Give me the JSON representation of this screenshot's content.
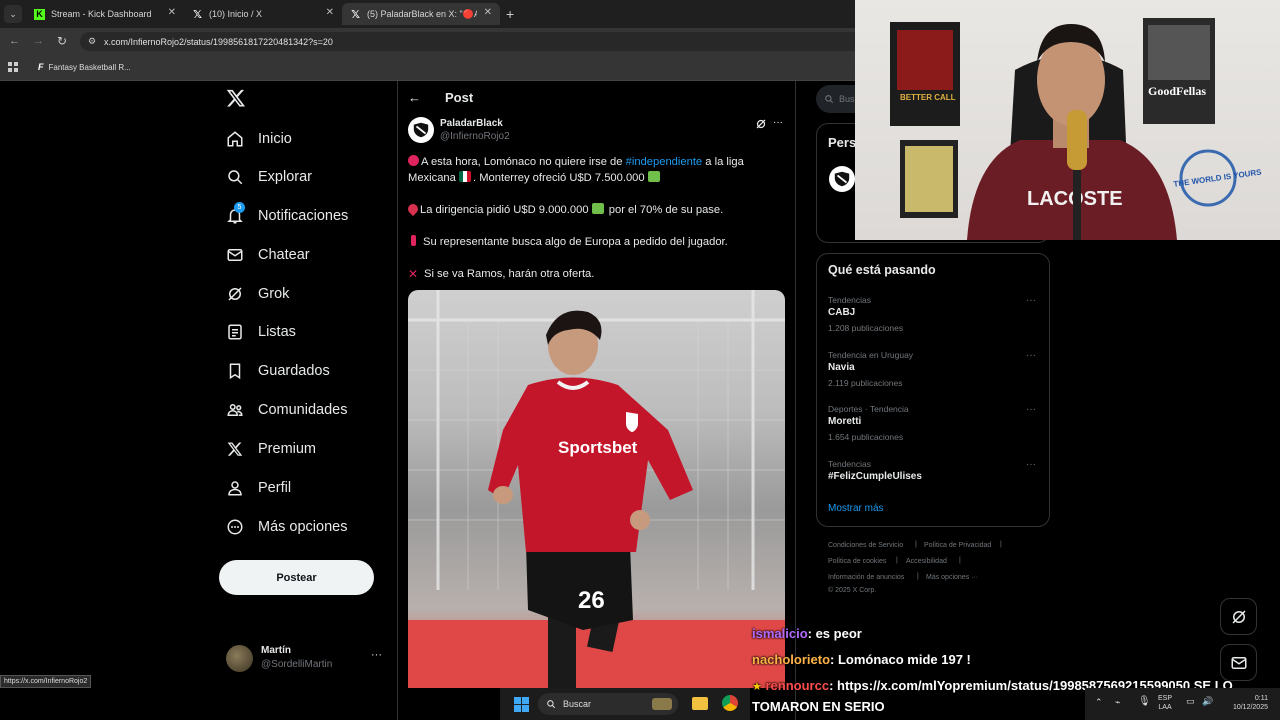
{
  "browser": {
    "tabs": [
      {
        "title": "Stream - Kick Dashboard"
      },
      {
        "title": "(10) Inicio / X"
      },
      {
        "title": "(5) PaladarBlack en X: \"🔴A est"
      }
    ],
    "url": "x.com/InfiernoRojo2/status/1998561817220481342?s=20",
    "bookmark": "Fantasy Basketball R...",
    "status_url": "https://x.com/InfiernoRojo2"
  },
  "nav": {
    "items": [
      {
        "label": "Inicio",
        "icon": "home-icon"
      },
      {
        "label": "Explorar",
        "icon": "search-icon"
      },
      {
        "label": "Notificaciones",
        "icon": "bell-icon",
        "badge": "5"
      },
      {
        "label": "Chatear",
        "icon": "envelope-icon"
      },
      {
        "label": "Grok",
        "icon": "grok-icon"
      },
      {
        "label": "Listas",
        "icon": "list-icon"
      },
      {
        "label": "Guardados",
        "icon": "bookmark-icon"
      },
      {
        "label": "Comunidades",
        "icon": "communities-icon"
      },
      {
        "label": "Premium",
        "icon": "x-logo-icon"
      },
      {
        "label": "Perfil",
        "icon": "person-icon"
      },
      {
        "label": "Más opciones",
        "icon": "more-circle-icon"
      }
    ],
    "post_button": "Postear",
    "account": {
      "name": "Martín",
      "handle": "@SordelliMartin"
    }
  },
  "post": {
    "header": "Post",
    "author": {
      "name": "PaladarBlack",
      "handle": "@InfiernoRojo2"
    },
    "lines": {
      "l1a": "A esta hora, Lomónaco no quiere irse de ",
      "l1hash": "#independiente",
      "l1b": " a la liga",
      "l2": "Mexicana ",
      "l2b": ". Monterrey ofreció U$D 7.500.000 ",
      "l3": "La dirigencia pidió U$D 9.000.000 ",
      "l3b": " por el 70% de su pase.",
      "l4": "Su representante busca algo de Europa a pedido del jugador.",
      "l5": "Si se va Ramos, harán otra oferta."
    },
    "photo": {
      "jersey_brand": "Sportsbet",
      "jersey_number": "26"
    }
  },
  "right": {
    "search_placeholder": "Bus",
    "section_partial": "Pers",
    "trends_title": "Qué está pasando",
    "trends": [
      {
        "category": "Tendencias",
        "name": "CABJ",
        "count": "1.208 publicaciones"
      },
      {
        "category": "Tendencia en Uruguay",
        "name": "Navia",
        "count": "2.119 publicaciones"
      },
      {
        "category": "Deportes · Tendencia",
        "name": "Moretti",
        "count": "1.654 publicaciones"
      },
      {
        "category": "Tendencias",
        "name": "#FelizCumpleUlises",
        "count": ""
      }
    ],
    "show_more": "Mostrar más",
    "footer": {
      "terms": "Condiciones de Servicio",
      "privacy": "Política de Privacidad",
      "cookies": "Política de cookies",
      "accessibility": "Accesibilidad",
      "ads": "Información de anuncios",
      "more": "Más opciones ···",
      "copyright": "© 2025 X Corp."
    }
  },
  "webcam": {
    "shirt_text": "LACOSTE",
    "poster": "GoodFellas",
    "sticker": "THE WORLD IS YOURS"
  },
  "chat": [
    {
      "user": "ismalicio",
      "color": "#b36bff",
      "text": ": es peor"
    },
    {
      "user": "nacholorieto",
      "color": "#ffb347",
      "text": ": Lomónaco mide 197 !"
    },
    {
      "user": "rennourcc",
      "color": "#ff4d4d",
      "text": ": https://x.com/mlYopremium/status/1998587569215599050 SE LO"
    },
    {
      "user": "",
      "color": "#ffffff",
      "text": "TOMARON EN SERIO"
    }
  ],
  "taskbar": {
    "search": "Buscar",
    "lang1": "ESP",
    "lang2": "LAA",
    "time": "0:11",
    "date": "10/12/2025"
  },
  "colors": {
    "accent": "#1d9bf0",
    "background": "#000000",
    "border": "#2f3336",
    "muted": "#71767b"
  }
}
